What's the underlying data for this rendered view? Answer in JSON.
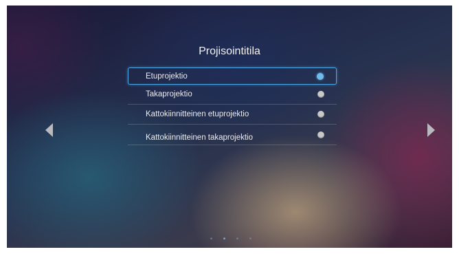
{
  "screen": {
    "title": "Projisointitila",
    "options": [
      {
        "label": "Etuprojektio",
        "selected": true
      },
      {
        "label": "Takaprojektio",
        "selected": false
      },
      {
        "label": "Kattokiinnitteinen etuprojektio",
        "selected": false
      },
      {
        "label": "Kattokiinnitteinen takaprojektio",
        "selected": false
      }
    ],
    "nav": {
      "left_icon": "triangle-left-icon",
      "right_icon": "triangle-right-icon"
    },
    "page_indicator": {
      "count": 4,
      "active_index": 1
    },
    "colors": {
      "accent": "#4aa7e3",
      "radio_on": "#6fbcec",
      "radio_off": "#c8c8c8"
    }
  }
}
